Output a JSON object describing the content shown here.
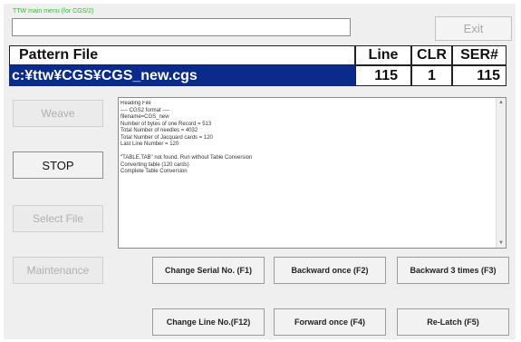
{
  "window": {
    "title": "TTW main menu (for CGS/2)",
    "top_input_value": "",
    "exit_label": "Exit"
  },
  "header": {
    "pattern_file_label": "Pattern File",
    "line_label": "Line",
    "clr_label": "CLR",
    "ser_label": "SER#"
  },
  "values": {
    "pattern_file_path": "c:¥ttw¥CGS¥CGS_new.cgs",
    "line": "115",
    "clr": "1",
    "ser": "115"
  },
  "side_buttons": {
    "weave": "Weave",
    "stop": "STOP",
    "select_file": "Select File",
    "maintenance": "Maintenance"
  },
  "log": {
    "lines": [
      "Reading File",
      "---- CGS2 format ----",
      "filename=CGS_new",
      "Number of bytes of one Record = 513",
      "Total Number of needles       = 4032",
      "Total Number of Jacquard cards = 120",
      "Last Line Number      = 120",
      "",
      "\"TABLE.TAB\" not found. Run without Table Conversion",
      "Converting table (120 cards)",
      "Complete Table Conversion"
    ]
  },
  "function_buttons": {
    "change_serial": "Change Serial No. (F1)",
    "backward_once": "Backward once (F2)",
    "backward_3": "Backward 3 times (F3)",
    "change_line": "Change Line No.(F12)",
    "forward_once": "Forward once (F4)",
    "relatch": "Re-Latch (F5)"
  },
  "colors": {
    "path_highlight": "#0a2a8c",
    "title_green": "#22cc22"
  }
}
